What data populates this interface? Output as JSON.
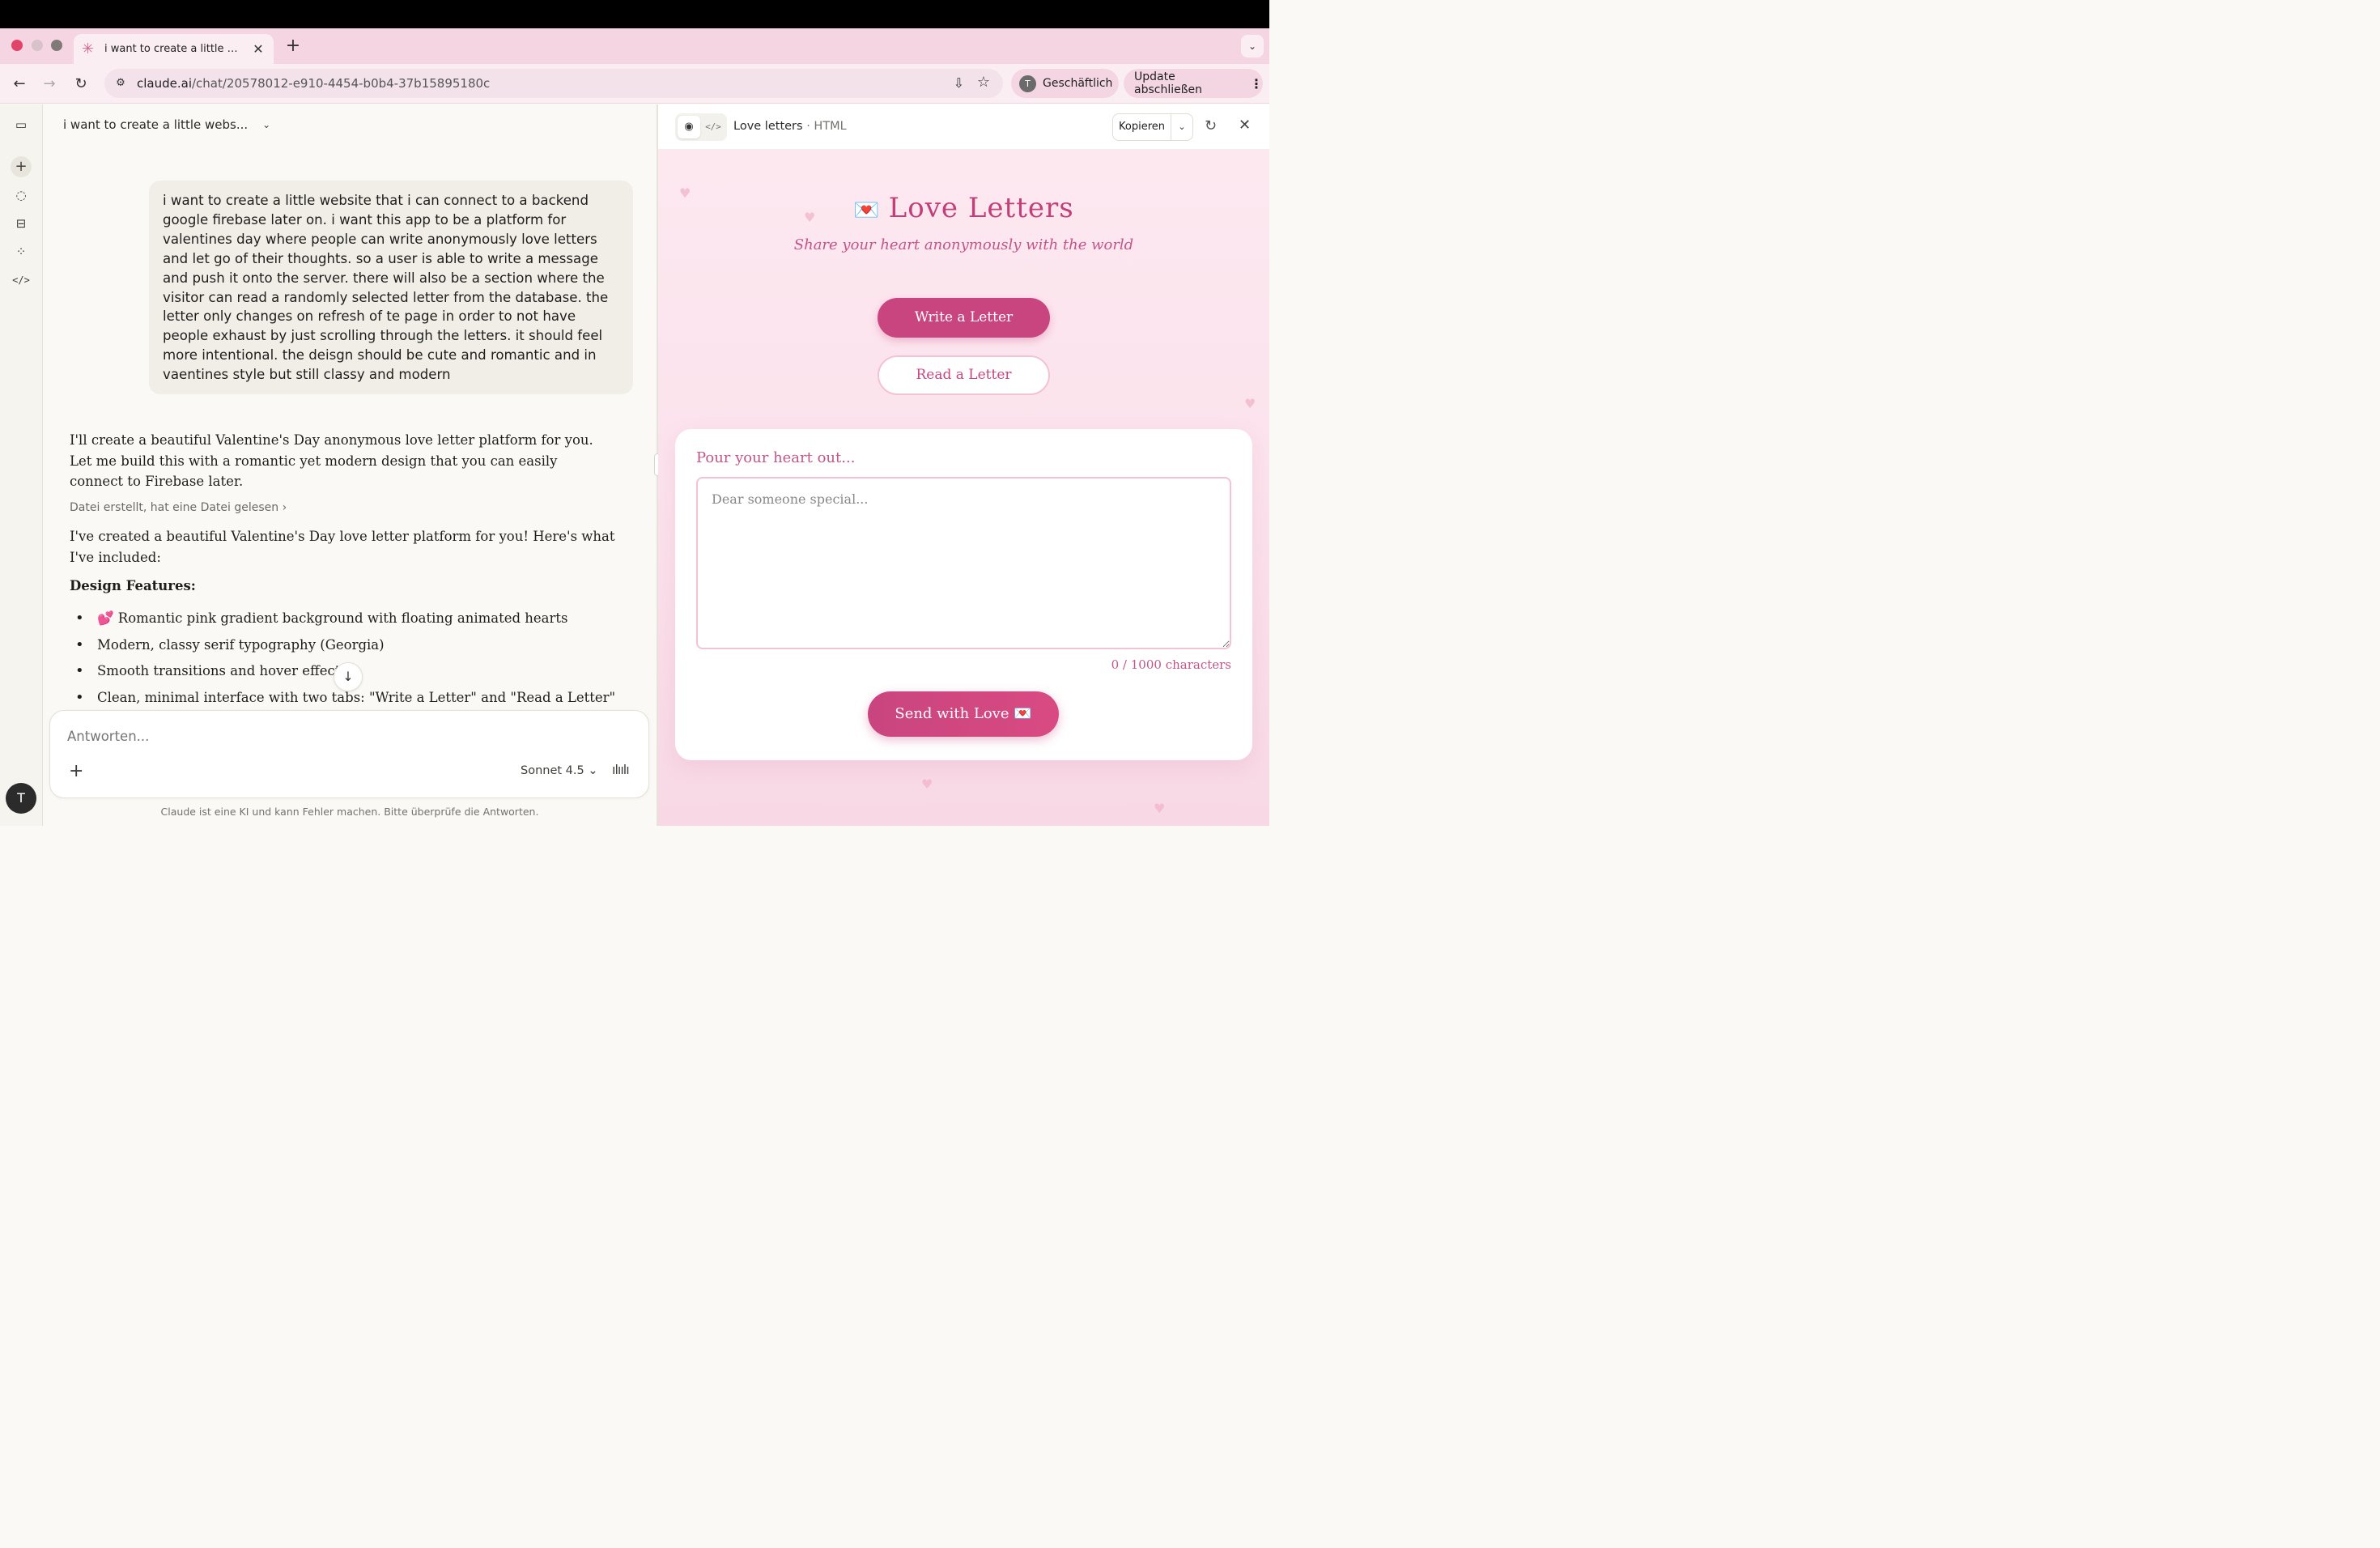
{
  "browser": {
    "tab_title": "i want to create a little websi…",
    "tab_close": "✕",
    "new_tab": "+",
    "url_host": "claude.ai",
    "url_path": "/chat/20578012-e910-4454-b0b4-37b15895180c",
    "profile_initial": "T",
    "profile_label": "Geschäftlich",
    "update_label": "Update abschließen"
  },
  "rail": {
    "avatar_initial": "T"
  },
  "chat": {
    "title": "i want to create a little webs...",
    "user_message": "i want to create a little website that i can connect to a backend google firebase later on. i want this app to be a platform for valentines day where people can write anonymously love letters and let go of their thoughts. so a user is able to write a message and push it onto the server. there will also be a section where the visitor can read a randomly selected letter from the database. the letter only changes on refresh of te page in order to not have people exhaust by just scrolling through the letters. it should feel more intentional. the deisgn should be cute and romantic and in vaentines style but still classy and modern",
    "response_intro": "I'll create a beautiful Valentine's Day anonymous love letter platform for you. Let me build this with a romantic yet modern design that you can easily connect to Firebase later.",
    "tool_summary": "Datei erstellt, hat eine Datei gelesen",
    "response_summary": "I've created a beautiful Valentine's Day love letter platform for you! Here's what I've included:",
    "design_heading": "Design Features:",
    "design_features": [
      "💕 Romantic pink gradient background with floating animated hearts",
      "Modern, classy serif typography (Georgia)",
      "Smooth transitions and hover effects",
      "Clean, minimal interface with two tabs: \"Write a Letter\" and \"Read a Letter\""
    ],
    "composer_placeholder": "Antworten...",
    "model_label": "Sonnet 4.5",
    "disclaimer": "Claude ist eine KI und kann Fehler machen. Bitte überprüfe die Antworten."
  },
  "artifact": {
    "title": "Love letters",
    "type_label": "· HTML",
    "copy_label": "Kopieren"
  },
  "preview": {
    "app_title": "Love Letters",
    "subtitle": "Share your heart anonymously with the world",
    "write_button": "Write a Letter",
    "read_button": "Read a Letter",
    "prompt_label": "Pour your heart out...",
    "textarea_placeholder": "Dear someone special...",
    "char_count": "0 / 1000 characters",
    "send_button": "Send with Love 💌"
  },
  "colors": {
    "accent_pink": "#c9457f",
    "tab_strip": "#f6d5e3"
  }
}
